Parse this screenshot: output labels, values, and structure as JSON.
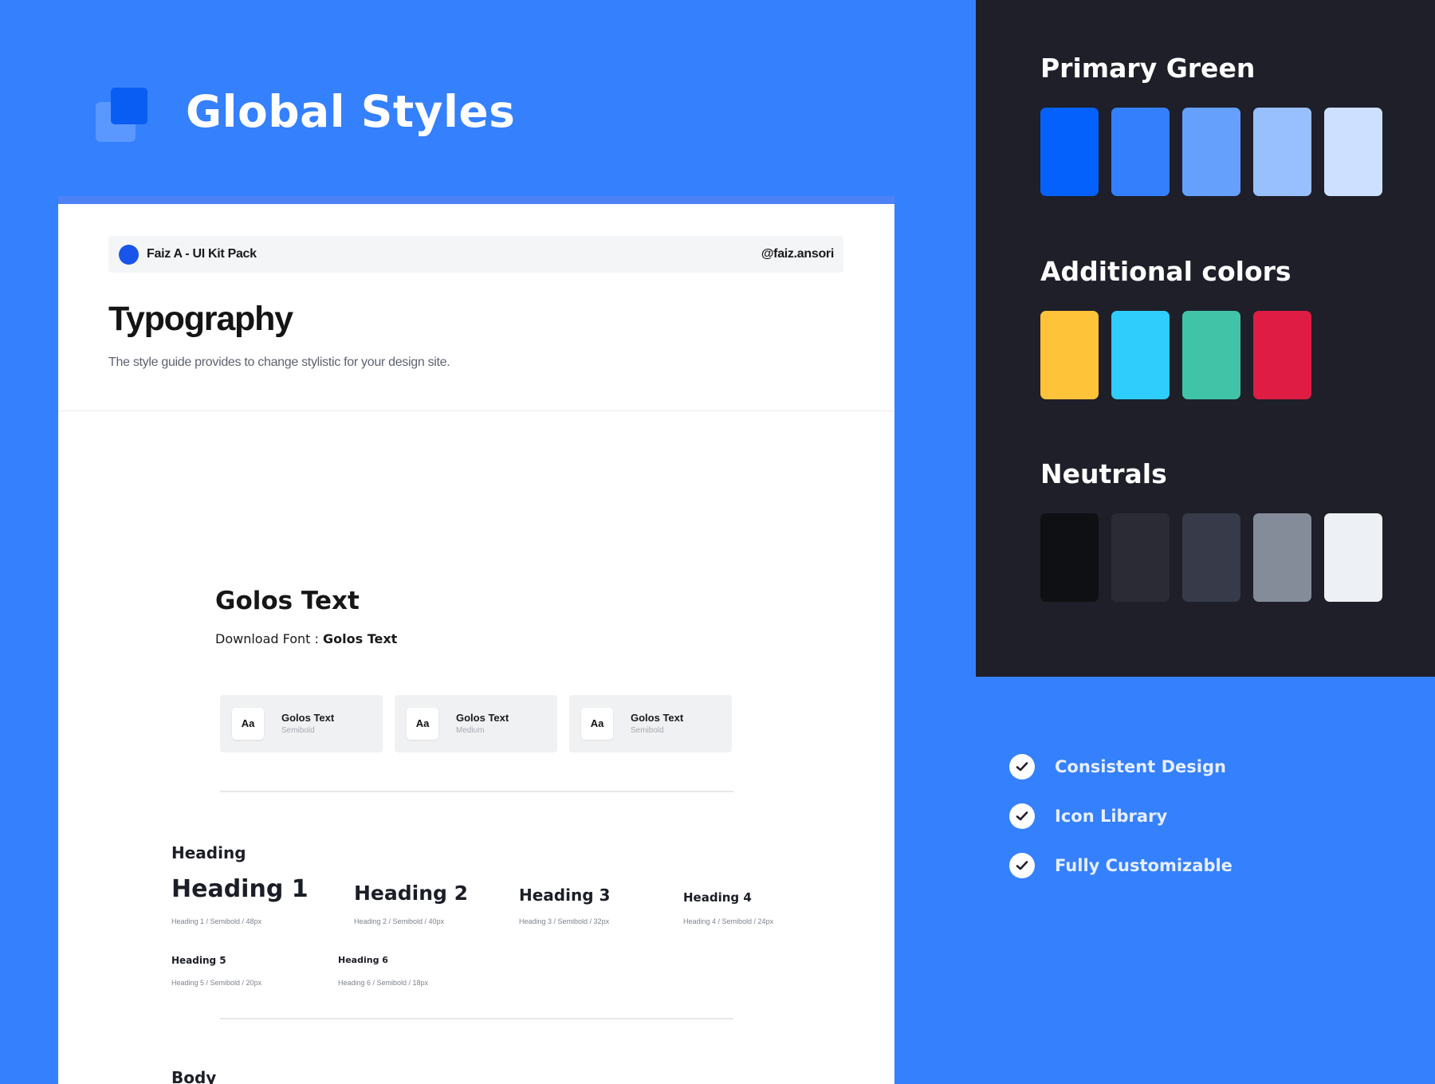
{
  "header": {
    "title": "Global Styles"
  },
  "doc": {
    "author": "Faiz A - UI Kit Pack",
    "handle": "@faiz.ansori",
    "title": "Typography",
    "subtitle": "The style guide provides to change stylistic for your design site.",
    "font_name": "Golos Text",
    "download_label": "Download Font : ",
    "download_font": "Golos Text",
    "weights": [
      {
        "aa": "Aa",
        "name": "Golos Text",
        "weight": "Semibold"
      },
      {
        "aa": "Aa",
        "name": "Golos Text",
        "weight": "Medium"
      },
      {
        "aa": "Aa",
        "name": "Golos Text",
        "weight": "Semibold"
      }
    ],
    "heading_section": "Heading",
    "headings": [
      {
        "label": "Heading 1",
        "meta": "Heading 1 / Semibold / 48px"
      },
      {
        "label": "Heading 2",
        "meta": "Heading 2 / Semibold / 40px"
      },
      {
        "label": "Heading 3",
        "meta": "Heading 3 / Semibold / 32px"
      },
      {
        "label": "Heading 4",
        "meta": "Heading 4 / Semibold / 24px"
      },
      {
        "label": "Heading 5",
        "meta": "Heading 5 / Semibold / 20px"
      },
      {
        "label": "Heading 6",
        "meta": "Heading 6 / Semibold / 18px"
      }
    ],
    "body_section": "Body"
  },
  "palette": {
    "primary": {
      "title": "Primary Green",
      "colors": [
        "#0561fb",
        "#3480fc",
        "#65a0fd",
        "#99c0fe",
        "#cde0ff"
      ]
    },
    "additional": {
      "title": "Additional colors",
      "colors": [
        "#ffc33a",
        "#2ecdfc",
        "#40c3a7",
        "#df1c44"
      ]
    },
    "neutrals": {
      "title": "Neutrals",
      "colors": [
        "#0f1013",
        "#2a2b35",
        "#373a48",
        "#848c9a",
        "#edf0f4"
      ]
    }
  },
  "features": [
    {
      "label": "Consistent Design",
      "icon": "check-circle-icon"
    },
    {
      "label": "Icon Library",
      "icon": "check-circle-icon"
    },
    {
      "label": "Fully Customizable",
      "icon": "check-circle-icon"
    }
  ]
}
